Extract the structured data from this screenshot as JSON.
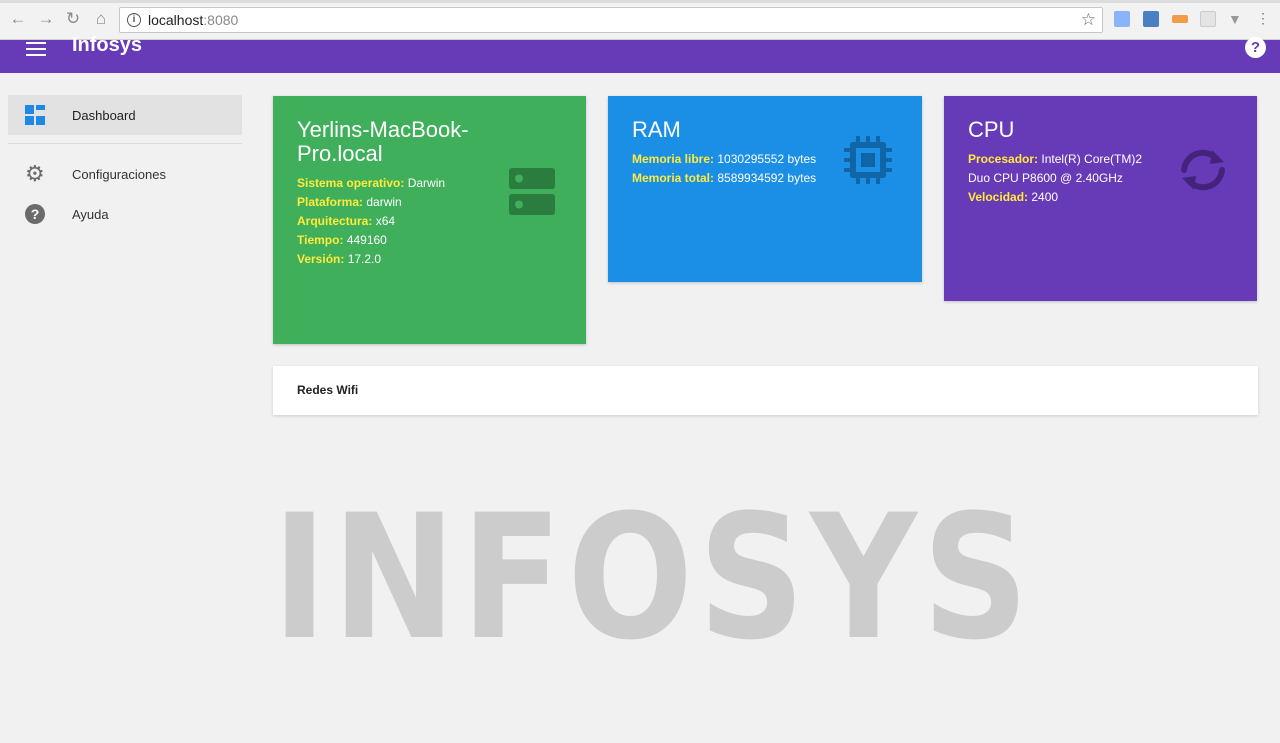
{
  "browser": {
    "url_host": "localhost",
    "url_port": ":8080"
  },
  "appbar": {
    "title": "Infosys"
  },
  "sidebar": {
    "items": [
      {
        "label": "Dashboard",
        "icon": "dashboard-icon"
      },
      {
        "label": "Configuraciones",
        "icon": "gear-icon"
      },
      {
        "label": "Ayuda",
        "icon": "help-icon"
      }
    ]
  },
  "cards": {
    "os": {
      "title": "Yerlins-MacBook-Pro.local",
      "rows": [
        {
          "key": "Sistema operativo:",
          "value": "Darwin"
        },
        {
          "key": "Plataforma:",
          "value": "darwin"
        },
        {
          "key": "Arquitectura:",
          "value": "x64"
        },
        {
          "key": "Tiempo:",
          "value": "449160"
        },
        {
          "key": "Versión:",
          "value": "17.2.0"
        }
      ],
      "icon": "server-icon",
      "color": "#3faf5b"
    },
    "ram": {
      "title": "RAM",
      "rows": [
        {
          "key": "Memoria libre:",
          "value": "1030295552 bytes"
        },
        {
          "key": "Memoria total:",
          "value": "8589934592 bytes"
        }
      ],
      "icon": "chip-icon",
      "color": "#1b8fe6"
    },
    "cpu": {
      "title": "CPU",
      "rows": [
        {
          "key": "Procesador:",
          "value": "Intel(R) Core(TM)2 Duo CPU P8600 @ 2.40GHz"
        },
        {
          "key": "Velocidad:",
          "value": "2400"
        }
      ],
      "icon": "sync-icon",
      "color": "#673ab7"
    }
  },
  "wifi": {
    "label": "Redes Wifi"
  },
  "watermark": "INFOSYS"
}
